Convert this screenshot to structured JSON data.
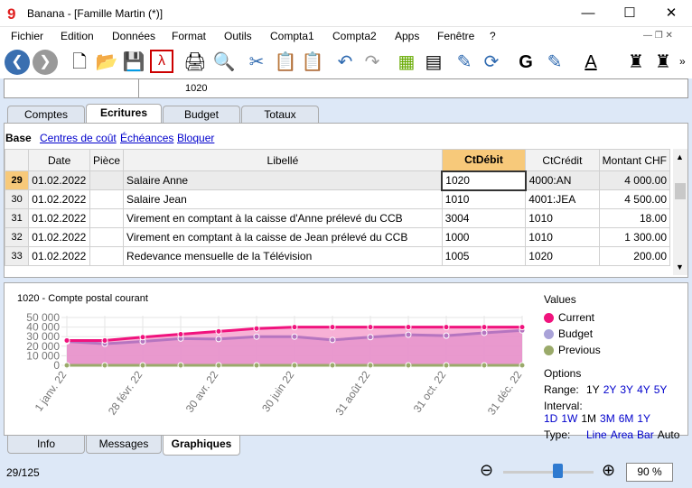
{
  "window": {
    "title": "Banana - [Famille Martin (*)]",
    "logo": "9",
    "controls": [
      "minimize-icon",
      "maximize-icon",
      "close-icon"
    ]
  },
  "menu": [
    "Fichier",
    "Edition",
    "Données",
    "Format",
    "Outils",
    "Compta1",
    "Compta2",
    "Apps",
    "Fenêtre",
    "?"
  ],
  "toolbar": [
    "back-icon",
    "forward-icon",
    "new-file-icon",
    "open-folder-icon",
    "save-icon",
    "pdf-icon",
    "print-icon",
    "print-preview-icon",
    "cut-icon",
    "copy-icon",
    "paste-icon",
    "undo-icon",
    "redo-icon",
    "insert-row-icon",
    "delete-row-icon",
    "edit-icon",
    "refresh-icon",
    "bold-icon",
    "highlight-icon",
    "font-color-icon",
    "find-icon",
    "find-next-icon"
  ],
  "toolbar_text": {
    "bold": "G",
    "font_color": "A",
    "more": "»"
  },
  "cellbar": {
    "value": "1020"
  },
  "tabs": [
    "Comptes",
    "Ecritures",
    "Budget",
    "Totaux"
  ],
  "active_tab": "Ecritures",
  "views": {
    "active": "Base",
    "links": [
      "Centres de coût",
      "Échéances",
      "Bloquer"
    ]
  },
  "table": {
    "headers": [
      "Date",
      "Pièce",
      "Libellé",
      "CtDébit",
      "CtCrédit",
      "Montant CHF"
    ],
    "rows": [
      {
        "n": "29",
        "date": "01.02.2022",
        "piece": "",
        "libelle": "Salaire Anne",
        "debit": "1020",
        "credit": "4000:AN",
        "montant": "4 000.00"
      },
      {
        "n": "30",
        "date": "01.02.2022",
        "piece": "",
        "libelle": "Salaire Jean",
        "debit": "1010",
        "credit": "4001:JEA",
        "montant": "4 500.00"
      },
      {
        "n": "31",
        "date": "01.02.2022",
        "piece": "",
        "libelle": "Virement en comptant à la caisse d'Anne prélevé du CCB",
        "debit": "3004",
        "credit": "1010",
        "montant": "18.00"
      },
      {
        "n": "32",
        "date": "01.02.2022",
        "piece": "",
        "libelle": "Virement en comptant à la caisse de Jean prélevé du CCB",
        "debit": "1000",
        "credit": "1010",
        "montant": "1 300.00"
      },
      {
        "n": "33",
        "date": "01.02.2022",
        "piece": "",
        "libelle": "Redevance mensuelle de la Télévision",
        "debit": "1005",
        "credit": "1020",
        "montant": "200.00"
      }
    ]
  },
  "chart_data": {
    "type": "area",
    "title": "1020 - Compte postal courant",
    "ylim": [
      0,
      50000
    ],
    "yticks": [
      "50 000",
      "40 000",
      "30 000",
      "20 000",
      "10 000",
      "0"
    ],
    "xticks": [
      "1 janv. 22",
      "28 févr. 22",
      "30 avr. 22",
      "30 juin 22",
      "31 août 22",
      "31 oct. 22",
      "31 déc. 22"
    ],
    "series": [
      {
        "name": "Current",
        "color": "#f0137d",
        "values": [
          26000,
          26000,
          29500,
          32500,
          35500,
          38500,
          40000,
          40000,
          40000,
          40000,
          40000,
          40000,
          40000
        ]
      },
      {
        "name": "Budget",
        "color": "#a9a2d8",
        "values": [
          25000,
          22500,
          25000,
          28000,
          27500,
          30000,
          30000,
          26500,
          29500,
          32000,
          31000,
          34000,
          36500
        ]
      },
      {
        "name": "Previous",
        "color": "#9aaa6a",
        "values": [
          0,
          0,
          0,
          0,
          0,
          0,
          0,
          0,
          0,
          0,
          0,
          0,
          0
        ]
      }
    ],
    "legend_title": "Values"
  },
  "options": {
    "title": "Options",
    "range_label": "Range:",
    "range": [
      "1Y",
      "2Y",
      "3Y",
      "4Y",
      "5Y"
    ],
    "range_sel": "1Y",
    "interval_label": "Interval:",
    "interval": [
      "1D",
      "1W",
      "1M",
      "3M",
      "6M",
      "1Y"
    ],
    "interval_sel": "1M",
    "type_label": "Type:",
    "types": [
      "Line",
      "Area",
      "Bar",
      "Auto"
    ],
    "type_sel": "Auto"
  },
  "bottom_tabs": [
    "Info",
    "Messages",
    "Graphiques"
  ],
  "status": {
    "position": "29/125",
    "zoom": "90 %",
    "zoom_level": 0.6
  }
}
